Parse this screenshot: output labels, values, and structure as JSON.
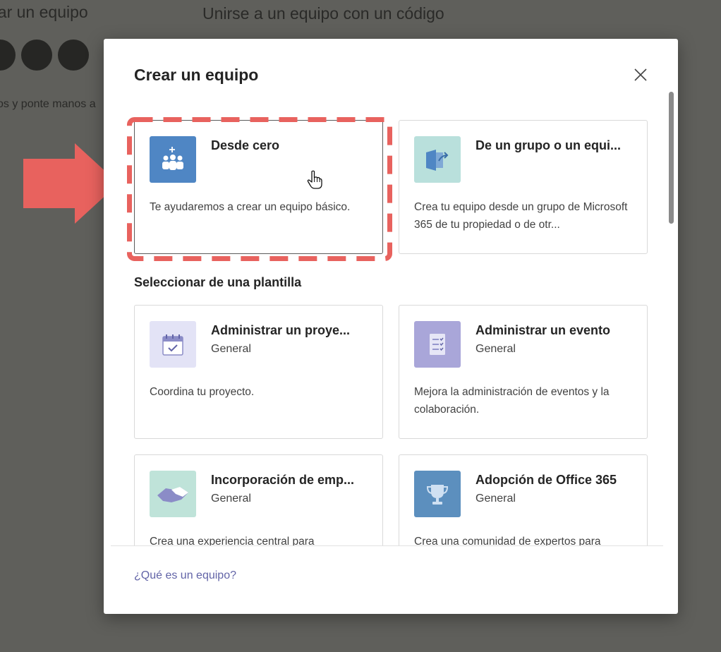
{
  "background": {
    "left_title": "ear un equipo",
    "right_title": "Unirse a un equipo con un código",
    "left_text": "os y ponte manos a"
  },
  "dialog": {
    "title": "Crear un equipo",
    "close_icon": "close-icon",
    "footer_link": "¿Qué es un equipo?"
  },
  "create_options": [
    {
      "name": "Desde cero",
      "description": "Te ayudaremos a crear un equipo básico.",
      "icon": "people-plus-icon",
      "tile_color": "#4f86c4",
      "selected": true
    },
    {
      "name": "De un grupo o un equi...",
      "description": "Crea tu equipo desde un grupo de Microsoft 365 de tu propiedad o de otr...",
      "icon": "group-share-icon",
      "tile_color": "#b9e0dc"
    }
  ],
  "template_section": {
    "heading": "Seleccionar de una plantilla"
  },
  "templates": [
    {
      "name": "Administrar un proye...",
      "category": "General",
      "description": "Coordina tu proyecto.",
      "icon": "calendar-check-icon",
      "tile_color": "#e3e3f6"
    },
    {
      "name": "Administrar un evento",
      "category": "General",
      "description": "Mejora la administración de eventos y la colaboración.",
      "icon": "checklist-icon",
      "tile_color": "#a9a6d9"
    },
    {
      "name": "Incorporación de emp...",
      "category": "General",
      "description": "Crea una experiencia central para",
      "icon": "handshake-icon",
      "tile_color": "#bfe3d9"
    },
    {
      "name": "Adopción de Office 365",
      "category": "General",
      "description": "Crea una comunidad de expertos para",
      "icon": "trophy-icon",
      "tile_color": "#5c8fbe"
    }
  ],
  "annotation": {
    "color": "#e8625e"
  }
}
